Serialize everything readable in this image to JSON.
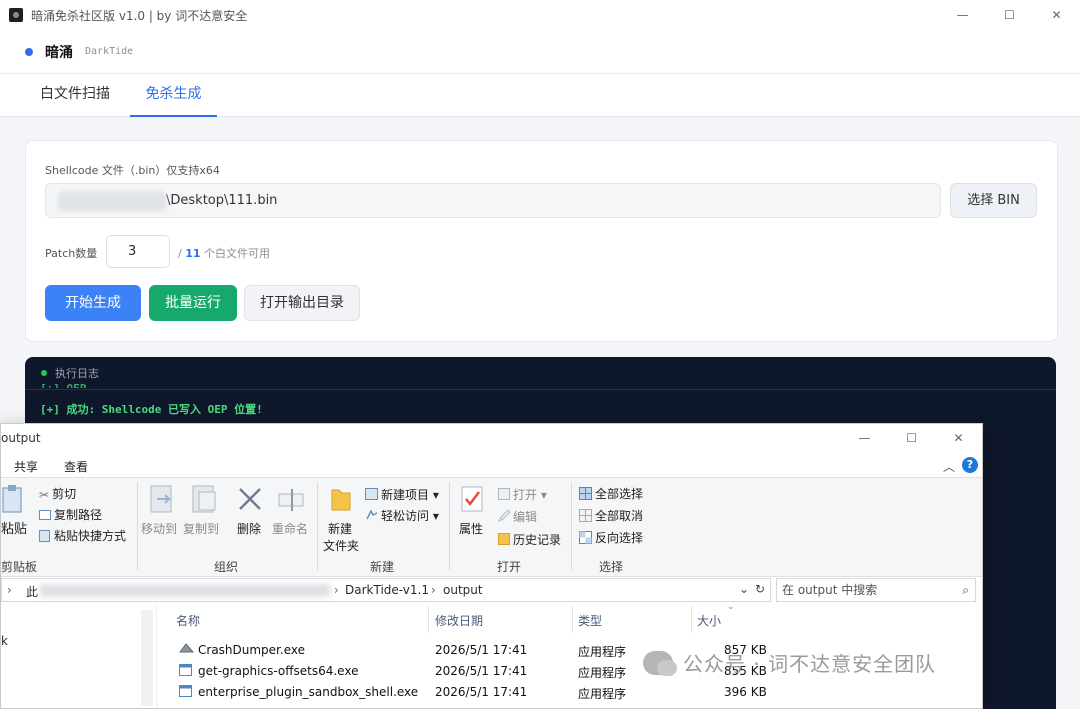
{
  "window": {
    "title": "暗涌免杀社区版 v1.0 | by 词不达意安全",
    "controls": [
      "—",
      "☐",
      "✕"
    ]
  },
  "brand": {
    "name": "暗涌",
    "sub": "DarkTide"
  },
  "tabs": [
    {
      "label": "白文件扫描",
      "active": false
    },
    {
      "label": "免杀生成",
      "active": true
    }
  ],
  "form": {
    "shellcode_label": "Shellcode 文件（.bin）仅支持x64",
    "shellcode_path": "\\Desktop\\111.bin",
    "choose_button": "选择 BIN",
    "patch_label": "Patch数量",
    "patch_value": "3",
    "patch_hint_prefix": "/ ",
    "patch_hint_count": "11",
    "patch_hint_suffix": " 个白文件可用",
    "buttons": {
      "generate": "开始生成",
      "batch": "批量运行",
      "open_output": "打开输出目录"
    }
  },
  "log": {
    "title": "执行日志",
    "lines": [
      "[+] 成功: Shellcode 已写入 OEP 位置!"
    ]
  },
  "explorer": {
    "title": "output",
    "ribbon_tabs": [
      "共享",
      "查看"
    ],
    "groups": {
      "clipboard": {
        "label": "剪贴板",
        "paste": "粘贴",
        "cut": "剪切",
        "copy_path": "复制路径",
        "paste_shortcut": "粘贴快捷方式"
      },
      "organize": {
        "label": "组织",
        "move_to": "移动到",
        "copy_to": "复制到",
        "delete": "删除",
        "rename": "重命名"
      },
      "new": {
        "label": "新建",
        "new_folder_line1": "新建",
        "new_folder_line2": "文件夹",
        "new_item": "新建项目",
        "easy_access": "轻松访问"
      },
      "open": {
        "label": "打开",
        "properties": "属性",
        "open": "打开",
        "edit": "编辑",
        "history": "历史记录"
      },
      "select": {
        "label": "选择",
        "select_all": "全部选择",
        "select_none": "全部取消",
        "invert": "反向选择"
      }
    },
    "address": {
      "prefix": "此",
      "seg1": "DarkTide-v1.1",
      "seg2": "output"
    },
    "search_placeholder": "在 output 中搜索",
    "columns": [
      "名称",
      "修改日期",
      "类型",
      "大小"
    ],
    "files": [
      {
        "name": "CrashDumper.exe",
        "date": "2026/5/1 17:41",
        "type": "应用程序",
        "size": "857 KB"
      },
      {
        "name": "get-graphics-offsets64.exe",
        "date": "2026/5/1 17:41",
        "type": "应用程序",
        "size": "855 KB"
      },
      {
        "name": "enterprise_plugin_sandbox_shell.exe",
        "date": "2026/5/1 17:41",
        "type": "应用程序",
        "size": "396 KB"
      }
    ],
    "nav_fragment": "k"
  },
  "watermark": "公众号 · 词不达意安全团队",
  "colors": {
    "accent": "#2f6fec",
    "primary_button": "#3b82f6",
    "green_button": "#16a96b",
    "log_bg": "#0f172a",
    "log_text": "#4ade80"
  }
}
